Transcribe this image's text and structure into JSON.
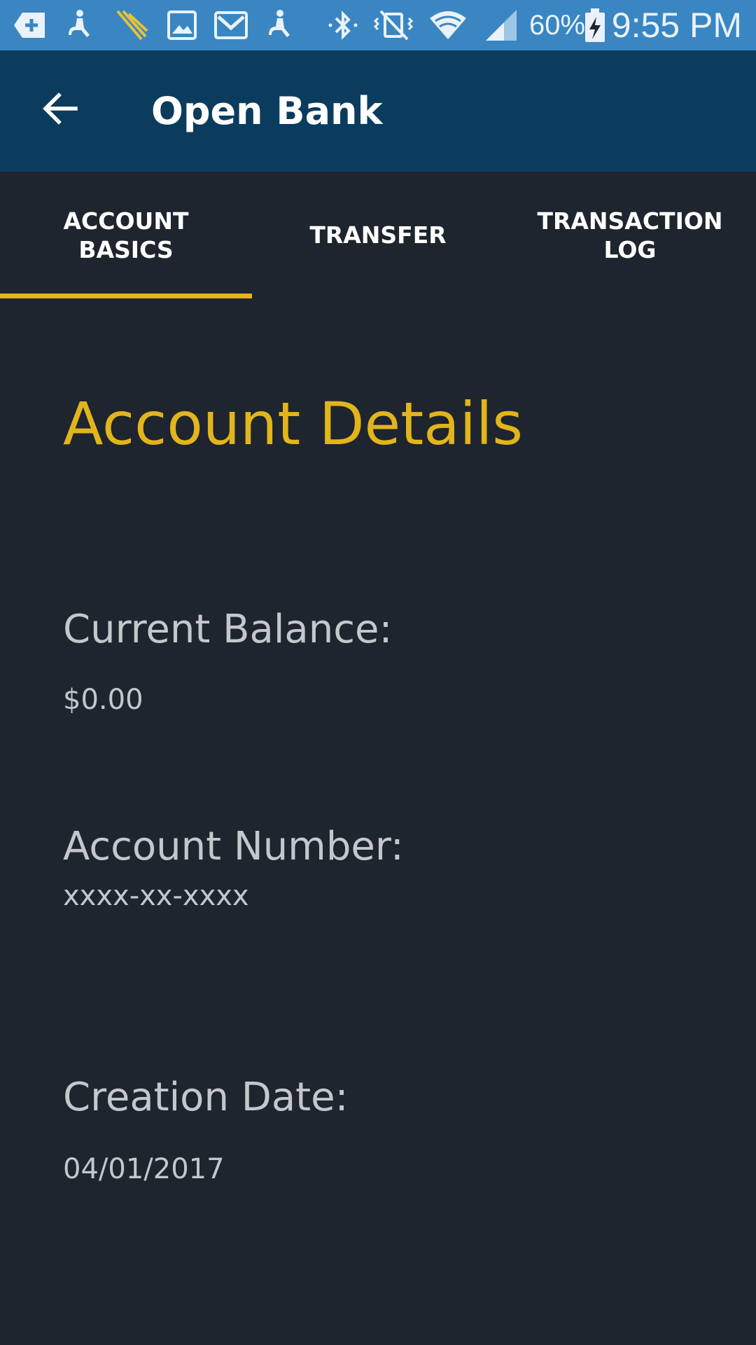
{
  "status_bar": {
    "battery_percent": "60%",
    "time": "9:55 PM",
    "icons": [
      "plus-box-icon",
      "accessibility-icon",
      "sprint-logo-icon",
      "image-icon",
      "gmail-icon",
      "accessibility-icon",
      "bluetooth-icon",
      "vibrate-mute-icon",
      "wifi-icon",
      "signal-icon",
      "battery-charging-icon"
    ]
  },
  "app_bar": {
    "back_icon": "arrow-back-icon",
    "title": "Open Bank"
  },
  "tabs": [
    {
      "label": "ACCOUNT BASICS",
      "selected": true
    },
    {
      "label": "TRANSFER",
      "selected": false
    },
    {
      "label": "TRANSACTION LOG",
      "selected": false
    }
  ],
  "account": {
    "heading": "Account Details",
    "balance_label": "Current Balance:",
    "balance_value": "$0.00",
    "number_label": "Account Number:",
    "number_value": "xxxx-xx-xxxx",
    "creation_label": "Creation Date:",
    "creation_value": "04/01/2017"
  },
  "colors": {
    "status_bar": "#3a86c3",
    "app_bar": "#0b3c5e",
    "background": "#1e252e",
    "accent": "#e2b51c",
    "text": "#c4c7cb"
  }
}
